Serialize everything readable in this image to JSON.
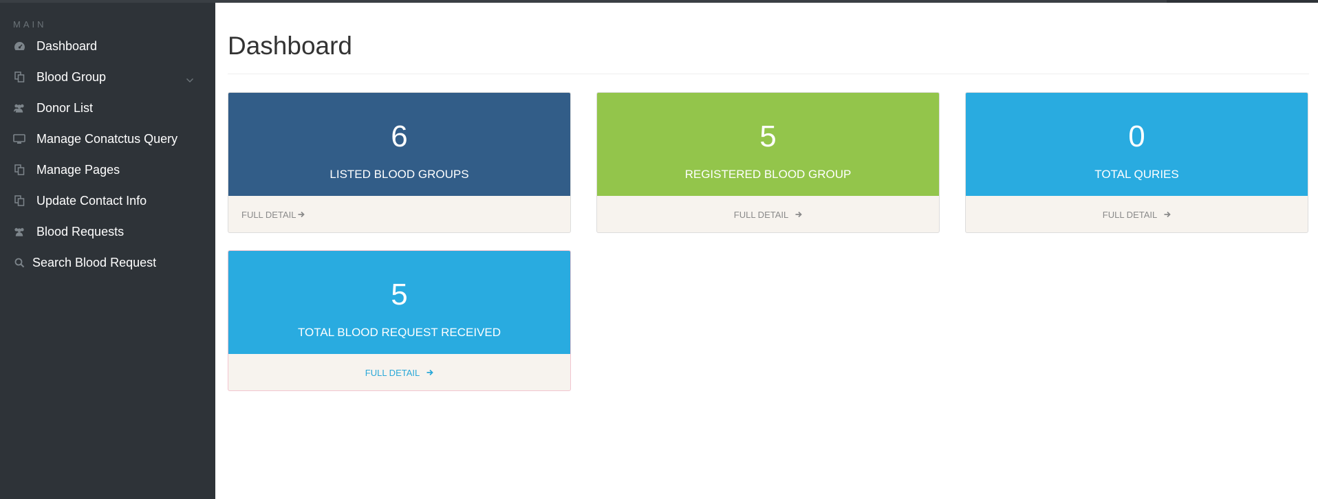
{
  "sidebar": {
    "heading": "MAIN",
    "items": [
      {
        "label": "Dashboard",
        "icon": "dashboard-icon"
      },
      {
        "label": "Blood Group",
        "icon": "copy-icon",
        "has_chevron": true
      },
      {
        "label": "Donor List",
        "icon": "users-icon"
      },
      {
        "label": "Manage Conatctus Query",
        "icon": "desktop-icon"
      },
      {
        "label": "Manage Pages",
        "icon": "copy-icon"
      },
      {
        "label": "Update Contact Info",
        "icon": "copy-icon"
      },
      {
        "label": "Blood Requests",
        "icon": "users-icon"
      },
      {
        "label": "Search Blood Request",
        "icon": "search-icon"
      }
    ]
  },
  "main": {
    "title": "Dashboard",
    "cards": [
      {
        "value": "6",
        "label": "LISTED BLOOD GROUPS",
        "link": "FULL DETAIL",
        "color": "#325d88"
      },
      {
        "value": "5",
        "label": "REGISTERED BLOOD GROUP",
        "link": "FULL DETAIL",
        "color": "#93c54b"
      },
      {
        "value": "0",
        "label": "TOTAL QURIES",
        "link": "FULL DETAIL",
        "color": "#29abe0"
      },
      {
        "value": "5",
        "label": "TOTAL BLOOD REQUEST RECEIVED",
        "link": "FULL DETAIL",
        "color": "#29abe0"
      }
    ]
  },
  "colors": {
    "sidebar_bg": "#2e3338",
    "card_footer_bg": "#f7f3ee",
    "link_blue": "#2aa8d8"
  }
}
